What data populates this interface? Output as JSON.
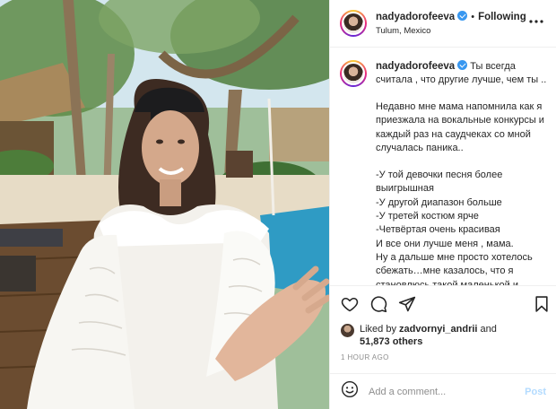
{
  "post": {
    "username": "nadyadorofeeva",
    "follow_separator": "•",
    "follow_status": "Following",
    "location": "Tulum, Mexico",
    "more_icon": "more-options-icon",
    "photo_alt": "photo"
  },
  "caption": {
    "username": "nadyadorofeeva",
    "first_line": "Ты всегда считала , что другие лучше, чем ты ..",
    "paragraph_1": "Недавно мне мама напомнила как я приезжала на вокальные конкурсы и каждый раз на саудчеках со мной случалась паника..",
    "lines": [
      "-У той девочки песня более выигрышная",
      "-У другой диапазон больше",
      "-У третей костюм ярче",
      "-Четвёртая очень красивая",
      "И все они лучше меня , мама.",
      "Ну а дальше мне просто хотелось сбежать…мне казалось, что я становлюсь такой маленькой и жалкой("
    ]
  },
  "actions": {
    "like_icon": "heart-icon",
    "comment_icon": "comment-icon",
    "share_icon": "share-icon",
    "save_icon": "bookmark-icon"
  },
  "likes": {
    "prefix": "Liked by",
    "user": "zadvornyi_andrii",
    "conjunction": "and",
    "others": "51,873 others"
  },
  "timestamp": "1 HOUR AGO",
  "comment": {
    "emoji_icon": "emoji-icon",
    "placeholder": "Add a comment...",
    "post_label": "Post"
  },
  "colors": {
    "verified": "#3897f0",
    "post_disabled": "#b3dbff",
    "muted_text": "#8e8e8e"
  }
}
